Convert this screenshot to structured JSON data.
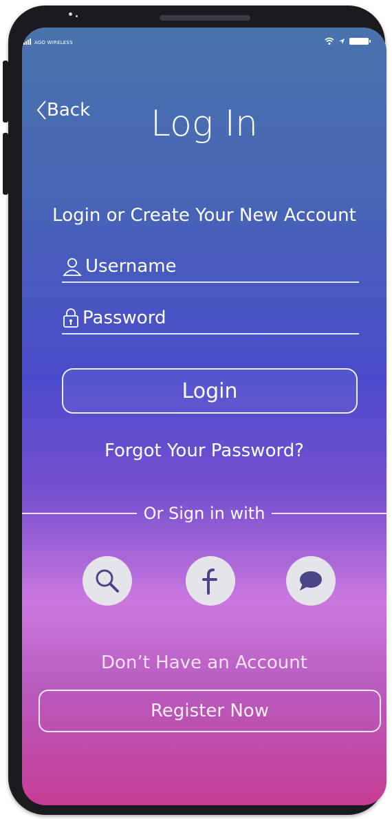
{
  "status_bar": {
    "carrier": "AGO WIRELESS"
  },
  "header": {
    "back_label": "Back",
    "title": "Log In"
  },
  "subtitle": "Login or Create Your New Account",
  "form": {
    "username_placeholder": "Username",
    "password_placeholder": "Password",
    "login_label": "Login",
    "forgot_label": "Forgot Your Password?"
  },
  "social": {
    "divider_label": "Or Sign in with",
    "icons": [
      "search-icon",
      "facebook-icon",
      "chat-icon"
    ]
  },
  "register": {
    "prompt": "Don’t Have an Account",
    "button_label": "Register Now"
  },
  "colors": {
    "gradient_top": "#4a73ad",
    "gradient_mid": "#4a4bcc",
    "gradient_pink": "#cb78de",
    "gradient_bottom": "#c63d94",
    "social_circle": "#e4e4ea",
    "icon_fill": "#4a4488"
  }
}
